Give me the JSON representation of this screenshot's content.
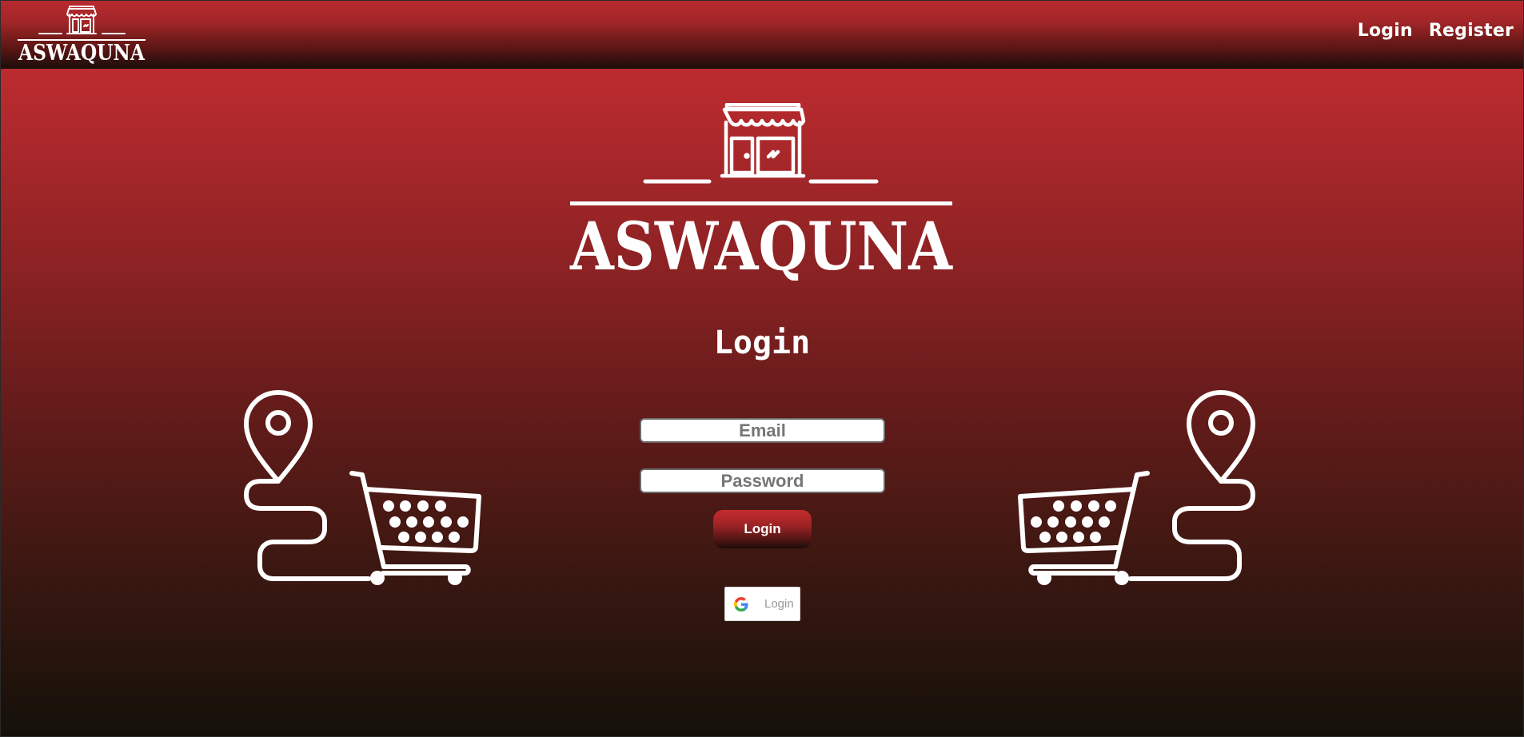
{
  "brand": {
    "name": "ASWAQUNA"
  },
  "nav": {
    "login_label": "Login",
    "register_label": "Register"
  },
  "page": {
    "title": "Login"
  },
  "form": {
    "email_placeholder": "Email",
    "email_value": "",
    "password_placeholder": "Password",
    "password_value": "",
    "submit_label": "Login"
  },
  "google": {
    "label": "Login",
    "icon": "google-icon"
  },
  "decor": {
    "left_icon": "shopping-route-icon",
    "right_icon": "shopping-route-icon"
  },
  "colors": {
    "brand_red": "#c12d31",
    "dark": "#141109",
    "white": "#ffffff",
    "input_border": "#6b6b6b"
  }
}
